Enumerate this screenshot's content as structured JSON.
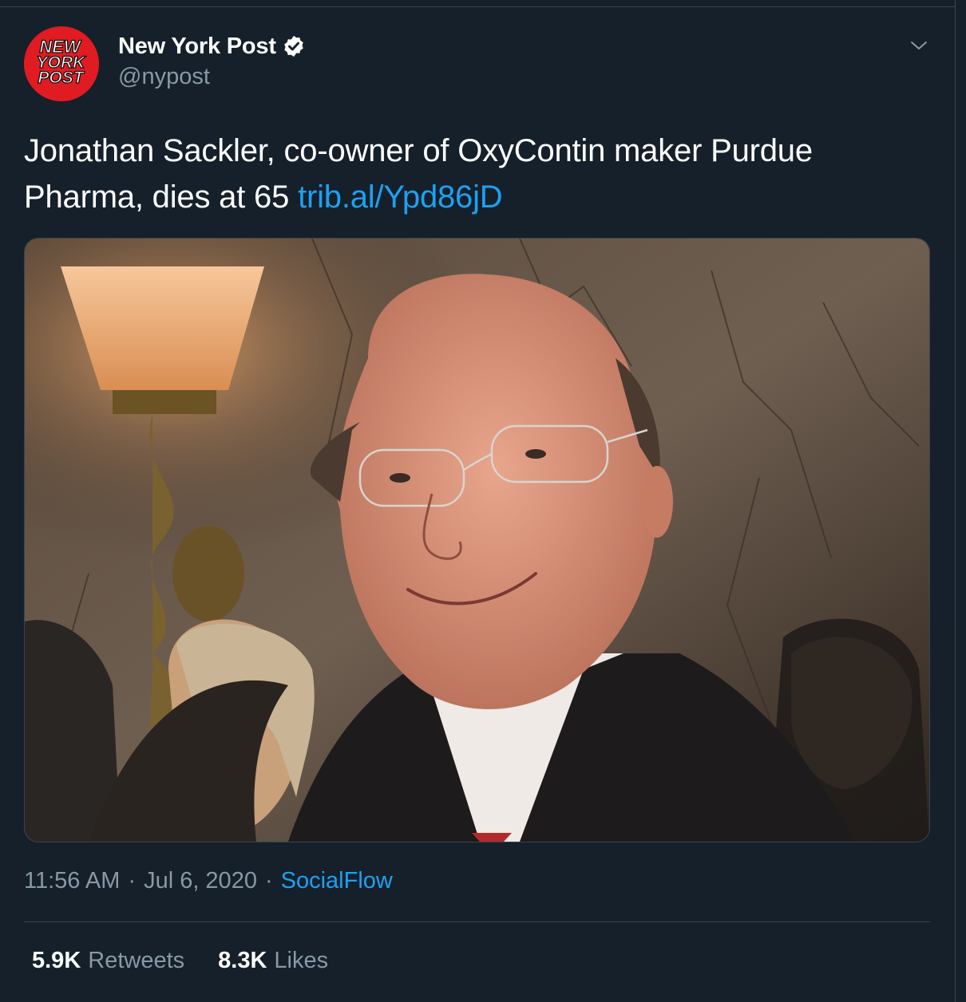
{
  "account": {
    "display_name": "New York Post",
    "handle": "@nypost",
    "verified": true,
    "avatar_logo": [
      "NEW",
      "YORK",
      "POST"
    ]
  },
  "tweet": {
    "text": "Jonathan Sackler, co-owner of OxyContin maker Purdue Pharma, dies at 65",
    "link_text": "trib.al/Ypd86jD"
  },
  "meta": {
    "time": "11:56 AM",
    "separator": "·",
    "date": "Jul 6, 2020",
    "source": "SocialFlow"
  },
  "stats": {
    "retweets_count": "5.9K",
    "retweets_label": "Retweets",
    "likes_count": "8.3K",
    "likes_label": "Likes"
  },
  "icons": {
    "verified": "verified-badge-icon",
    "more": "chevron-down-icon"
  },
  "colors": {
    "background": "#15202b",
    "accent": "#1da1f2",
    "secondary_text": "#8899a6",
    "border": "#38444d",
    "avatar_red": "#e01b22"
  }
}
